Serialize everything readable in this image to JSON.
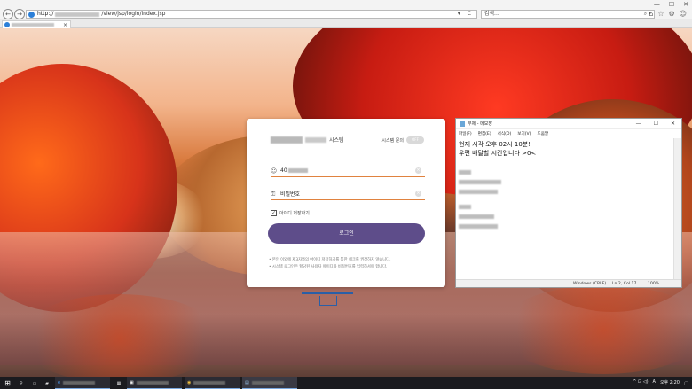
{
  "browser": {
    "address_prefix": "http://",
    "address_suffix": "/view/jsp/login/index.jsp",
    "address_icons": "▾ C",
    "search_placeholder": "검색...",
    "search_icons": "⌕ ▾",
    "nav_back": "←",
    "nav_forward": "→",
    "right_icons": [
      "⌂",
      "☆",
      "⚙",
      "☺"
    ],
    "window_controls": [
      "—",
      "☐",
      "✕"
    ],
    "tab_close": "×"
  },
  "login": {
    "system_label": "시스템",
    "system_toggle_label": "시스템 문의",
    "system_toggle_value": "OFF",
    "id_value": "40",
    "password_placeholder": "비밀번호",
    "remember_label": "아이디 저장하기",
    "remember_checked": true,
    "login_button": "로그인",
    "notes": [
      "• 본인 이외에 제3자와의 아이디 저장하기를 통한 체크를 권장하지 않습니다.",
      "• 시스템 로그인은 할당된 사용자 아이디와 비밀번호를 입력하셔야 합니다."
    ]
  },
  "notepad": {
    "title": "무제 - 메모장",
    "menu": [
      "파일(F)",
      "편집(E)",
      "서식(O)",
      "보기(V)",
      "도움말"
    ],
    "lines": [
      "현재 시각 오후 02시 10분!",
      "우편 배달할 시간입니다 >0<"
    ],
    "status": {
      "encoding": "Windows (CRLF)",
      "position": "Ln 2, Col 17",
      "zoom": "100%"
    }
  },
  "taskbar": {
    "clock": "오후 2:20",
    "ime": "A",
    "tray_icons": "^ ⊡ ◁)"
  }
}
